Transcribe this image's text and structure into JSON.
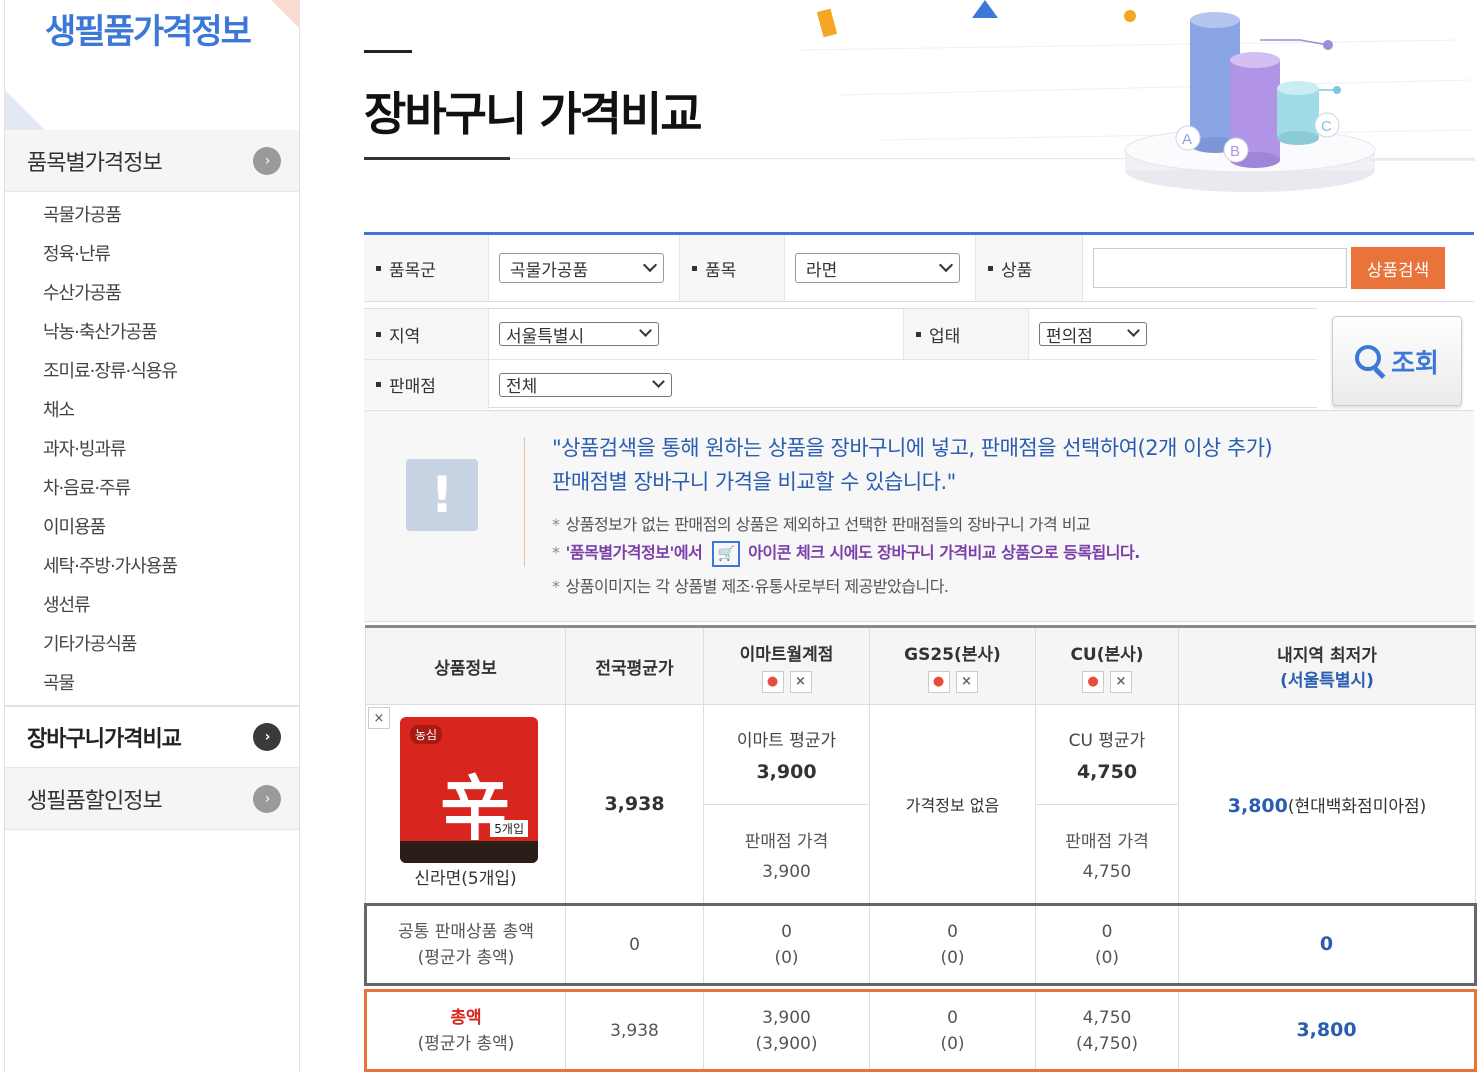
{
  "sidebar": {
    "title": "생필품가격정보",
    "groups": [
      {
        "label": "품목별가격정보",
        "arrow": "›"
      },
      {
        "label": "장바구니가격비교",
        "arrow": "›"
      },
      {
        "label": "생필품할인정보",
        "arrow": "›"
      }
    ],
    "sub_items": [
      "곡물가공품",
      "정육·난류",
      "수산가공품",
      "낙농·축산가공품",
      "조미료·장류·식용유",
      "채소",
      "과자·빙과류",
      "차·음료·주류",
      "이미용품",
      "세탁·주방·가사용품",
      "생선류",
      "기타가공식품",
      "곡물"
    ]
  },
  "page": {
    "title": "장바구니 가격비교"
  },
  "hero_labels": [
    "A",
    "B",
    "C"
  ],
  "search": {
    "category_group_label": "품목군",
    "category_group_value": "곡물가공품",
    "item_label": "품목",
    "item_value": "라면",
    "product_label": "상품",
    "product_placeholder": "",
    "search_button": "상품검색",
    "region_label": "지역",
    "region_value": "서울특별시",
    "biz_label": "업태",
    "biz_value": "편의점",
    "store_label": "판매점",
    "store_value": "전체",
    "query_button": "조회"
  },
  "info": {
    "icon": "!",
    "line1": "\"상품검색을 통해 원하는 상품을 장바구니에 넣고, 판매점을 선택하여(2개 이상 추가)",
    "line2": "판매점별 장바구니 가격을 비교할 수 있습니다.\"",
    "note1": "상품정보가 없는 판매점의 상품은 제외하고 선택한 판매점들의 장바구니 가격 비교",
    "note2_a": "'품목별가격정보'에서",
    "note2_b": "아이콘 체크 시에도 장바구니 가격비교 상품으로 등록됩니다.",
    "note3": "상품이미지는 각 상품별 제조·유통사로부터 제공받았습니다.",
    "star": "*"
  },
  "table": {
    "headers": {
      "product": "상품정보",
      "national_avg": "전국평균가",
      "store1": "이마트월계점",
      "store2": "GS25(본사)",
      "store3": "CU(본사)",
      "lowest": "내지역 최저가",
      "lowest_region": "(서울특별시)"
    },
    "remove_icon": "×",
    "product": {
      "name": "신라면(5개입)",
      "package_char": "辛",
      "package_brand": "농심",
      "package_count": "5개입",
      "national_avg": "3,938",
      "store1_avg_label": "이마트 평균가",
      "store1_avg": "3,900",
      "store1_price_label": "판매점 가격",
      "store1_price": "3,900",
      "store2_text": "가격정보 없음",
      "store3_avg_label": "CU 평균가",
      "store3_avg": "4,750",
      "store3_price_label": "판매점 가격",
      "store3_price": "4,750",
      "lowest_price": "3,800",
      "lowest_store": "(현대백화점미아점)"
    },
    "common_total": {
      "label1": "공통 판매상품 총액",
      "label2": "(평균가 총액)",
      "national": "0",
      "s1": "0",
      "s1_avg": "(0)",
      "s2": "0",
      "s2_avg": "(0)",
      "s3": "0",
      "s3_avg": "(0)",
      "lowest": "0"
    },
    "total": {
      "label1": "총액",
      "label2": "(평균가 총액)",
      "national": "3,938",
      "s1": "3,900",
      "s1_avg": "(3,900)",
      "s2": "0",
      "s2_avg": "(0)",
      "s3": "4,750",
      "s3_avg": "(4,750)",
      "lowest": "3,800"
    }
  }
}
